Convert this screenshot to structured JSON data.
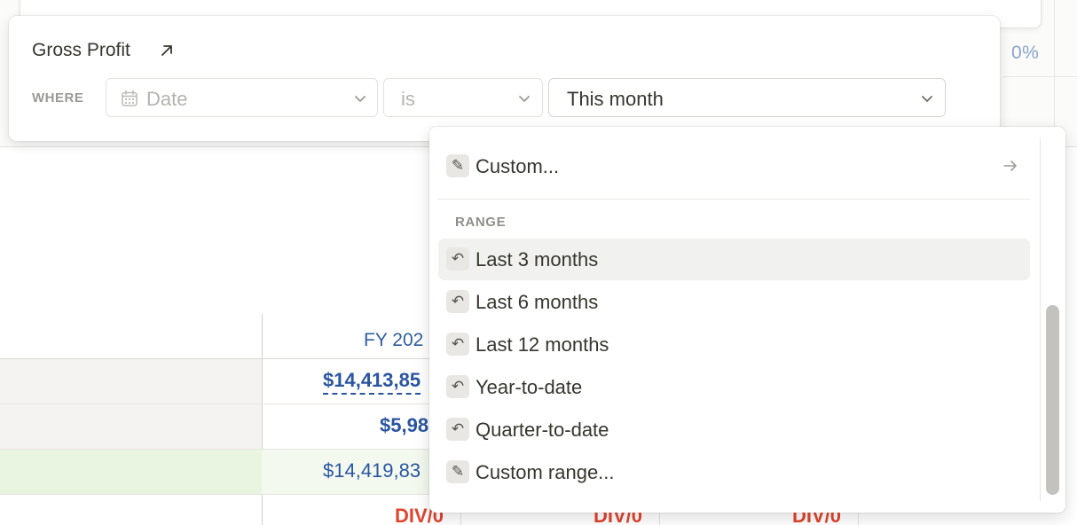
{
  "background": {
    "percent_value": "0%",
    "column_header": "FY 202",
    "rows": [
      {
        "value": "$14,413,85"
      },
      {
        "value": "$5,98"
      },
      {
        "value": "$14,419,83"
      },
      {
        "value": "DIV/0"
      }
    ],
    "bottom_errors": [
      "DIV/0",
      "DIV/0"
    ]
  },
  "filter": {
    "title": "Gross Profit",
    "where_label": "WHERE",
    "field": {
      "icon": "calendar-icon",
      "placeholder": "Date"
    },
    "operator": {
      "placeholder": "is"
    },
    "value": {
      "selected": "This month"
    }
  },
  "menu": {
    "custom_item": {
      "label": "Custom...",
      "icon": "custom-date-icon"
    },
    "section_label": "RANGE",
    "items": [
      {
        "label": "Last 3 months",
        "icon": "undo-arrow-icon",
        "highlighted": true
      },
      {
        "label": "Last 6 months",
        "icon": "undo-arrow-icon"
      },
      {
        "label": "Last 12 months",
        "icon": "undo-arrow-icon"
      },
      {
        "label": "Year-to-date",
        "icon": "undo-arrow-icon"
      },
      {
        "label": "Quarter-to-date",
        "icon": "undo-arrow-icon"
      },
      {
        "label": "Custom range...",
        "icon": "custom-date-icon"
      }
    ]
  },
  "colors": {
    "link_blue": "#2a55a0",
    "error_red": "#e0452e",
    "highlight": "#f1f1ef"
  }
}
